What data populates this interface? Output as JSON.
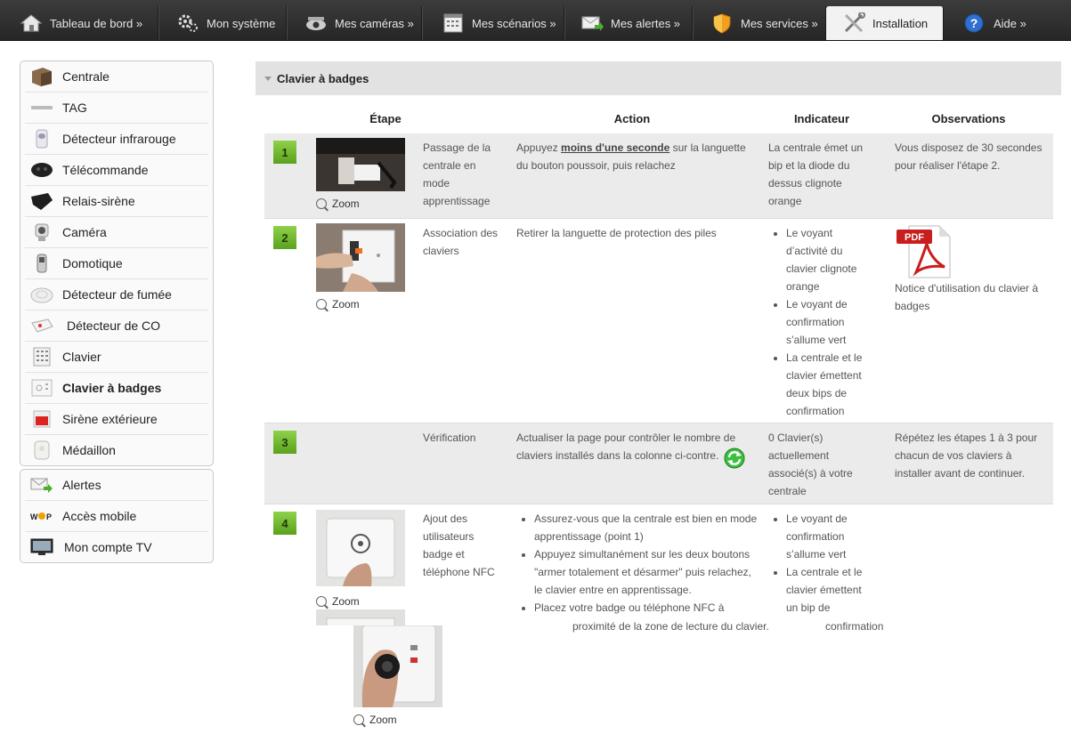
{
  "nav": {
    "tabs": [
      {
        "label": "Tableau de bord »",
        "icon": "home-icon"
      },
      {
        "label": "Mon système",
        "icon": "gears-icon"
      },
      {
        "label": "Mes caméras »",
        "icon": "camera-icon"
      },
      {
        "label": "Mes scénarios »",
        "icon": "calendar-icon"
      },
      {
        "label": "Mes alertes »",
        "icon": "envelope-icon"
      },
      {
        "label": "Mes services »",
        "icon": "shield-icon"
      },
      {
        "label": "Installation",
        "icon": "tools-icon"
      },
      {
        "label": "Aide »",
        "icon": "help-icon"
      }
    ],
    "active": "Installation"
  },
  "sidebar": {
    "devices": [
      "Centrale",
      "TAG",
      "Détecteur infrarouge",
      "Télécommande",
      "Relais-sirène",
      "Caméra",
      "Domotique",
      "Détecteur de fumée",
      "Détecteur de CO",
      "Clavier",
      "Clavier à badges",
      "Sirène extérieure",
      "Médaillon"
    ],
    "active": "Clavier à badges",
    "other": [
      "Alertes",
      "Accès mobile",
      "Mon compte TV"
    ]
  },
  "main": {
    "section_title": "Clavier à badges",
    "columns": {
      "etape": "Étape",
      "action": "Action",
      "indicateur": "Indicateur",
      "observations": "Observations"
    },
    "zoom_label": "Zoom",
    "steps": [
      {
        "num": "1",
        "title": "Passage de la centrale en mode apprentissage",
        "action_pre": "Appuyez ",
        "action_emph": "moins d'une seconde",
        "action_post": " sur la languette du bouton poussoir, puis relachez",
        "indicateur": "La centrale émet un bip et la diode du dessus clignote orange",
        "observations": "Vous disposez de 30 secondes pour réaliser l'étape 2."
      },
      {
        "num": "2",
        "title": "Association des claviers",
        "action": "Retirer la languette de protection des piles",
        "indicateurs": [
          "Le voyant d’activité du clavier clignote orange",
          "Le voyant de confirmation s’allume vert",
          "La centrale et le clavier émettent deux bips de confirmation"
        ],
        "pdf_label": "PDF",
        "observations": "Notice d'utilisation du clavier à badges"
      },
      {
        "num": "3",
        "title": "Vérification",
        "action": "Actualiser la page pour contrôler le nombre de claviers installés dans la colonne ci-contre.",
        "indicateur": "0 Clavier(s) actuellement associé(s) à votre centrale",
        "observations": "Répétez les étapes 1 à 3 pour chacun de vos claviers à installer avant de continuer."
      },
      {
        "num": "4",
        "title": "Ajout des utilisateurs badge et téléphone NFC",
        "actions": [
          "Assurez-vous que la centrale est bien en mode apprentissage (point 1)",
          "Appuyez simultanément sur les deux boutons \"armer totalement et désarmer\" puis relachez, le clavier entre en apprentissage.",
          "Placez votre badge ou téléphone NFC à"
        ],
        "action_overflow": "proximité de la zone de lecture du clavier.",
        "indicateurs": [
          "Le voyant de confirmation s’allume vert",
          "La centrale et le clavier émettent un bip de"
        ],
        "indicateur_overflow": "confirmation"
      }
    ]
  },
  "colors": {
    "accent_green": "#6bb52a",
    "nav_bg": "#2e2e2e",
    "row_grey": "#ebebeb",
    "header_grey": "#e2e2e2"
  }
}
